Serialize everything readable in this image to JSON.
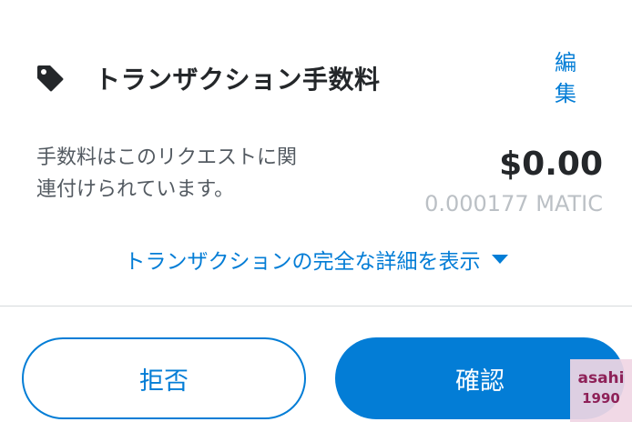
{
  "fee_section": {
    "icon": "tag-icon",
    "title": "トランザクション手数料",
    "edit_label_1": "編",
    "edit_label_2": "集",
    "description_line1": "手数料はこのリクエストに関",
    "description_line2": "連付けられています。",
    "fee_usd": "$0.00",
    "fee_crypto": "0.000177 MATIC"
  },
  "details_toggle": {
    "label": "トランザクションの完全な詳細を表示",
    "icon": "caret-down-icon"
  },
  "actions": {
    "reject_label": "拒否",
    "confirm_label": "確認"
  },
  "watermark": {
    "line1": "asahi",
    "line2": "1990"
  },
  "colors": {
    "primary": "#037dd6",
    "text": "#24272a",
    "muted": "#bbc0c5"
  }
}
